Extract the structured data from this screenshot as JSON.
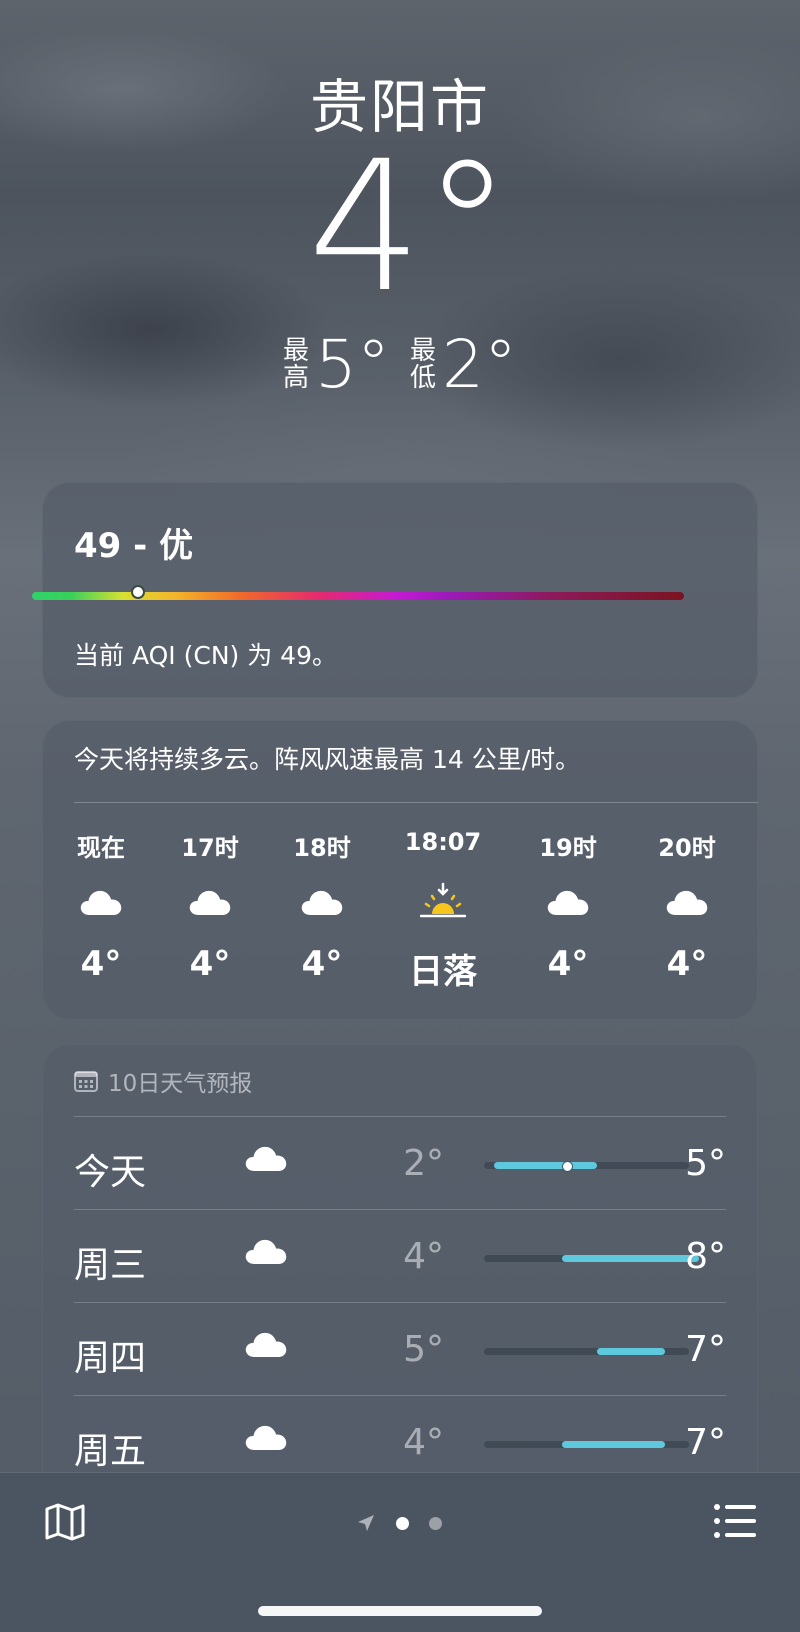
{
  "location": {
    "city": "贵阳市",
    "temperature": "4°",
    "high_label": [
      "最",
      "高"
    ],
    "high": "5°",
    "low_label": [
      "最",
      "低"
    ],
    "low": "2°"
  },
  "aqi": {
    "title": "49 - 优",
    "description": "当前 AQI (CN) 为 49。",
    "value": 49,
    "scale_max": 500
  },
  "hourly": {
    "summary": "今天将持续多云。阵风风速最高 14 公里/时。",
    "items": [
      {
        "time": "现在",
        "icon": "cloud-icon",
        "temp": "4°"
      },
      {
        "time": "17时",
        "icon": "cloud-icon",
        "temp": "4°"
      },
      {
        "time": "18时",
        "icon": "cloud-icon",
        "temp": "4°"
      },
      {
        "time": "18:07",
        "icon": "sunset-icon",
        "temp": "日落"
      },
      {
        "time": "19时",
        "icon": "cloud-icon",
        "temp": "4°"
      },
      {
        "time": "20时",
        "icon": "cloud-icon",
        "temp": "4°"
      }
    ]
  },
  "daily": {
    "header": "10日天气预报",
    "range": {
      "min": 2,
      "max": 8
    },
    "current_temp": 4,
    "days": [
      {
        "name": "今天",
        "icon": "cloud-icon",
        "low": "2°",
        "high": "5°",
        "low_val": 2,
        "high_val": 5
      },
      {
        "name": "周三",
        "icon": "cloud-icon",
        "low": "4°",
        "high": "8°",
        "low_val": 4,
        "high_val": 8
      },
      {
        "name": "周四",
        "icon": "cloud-icon",
        "low": "5°",
        "high": "7°",
        "low_val": 5,
        "high_val": 7
      },
      {
        "name": "周五",
        "icon": "cloud-icon",
        "low": "4°",
        "high": "7°",
        "low_val": 4,
        "high_val": 7
      }
    ]
  },
  "colors": {
    "range_bar": "#5ec8dc",
    "sun": "#f6c61d"
  },
  "toolbar": {
    "pages": 2,
    "active_page": 0
  }
}
